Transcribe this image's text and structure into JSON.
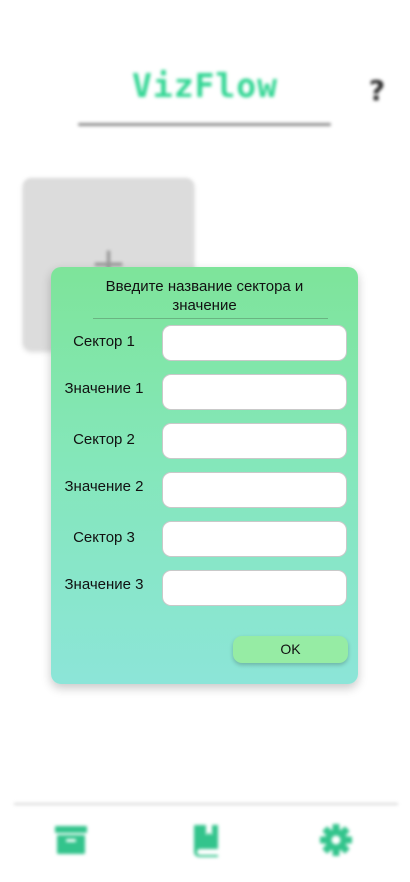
{
  "app": {
    "logo": "VizFlow",
    "help_label": "?",
    "add_card_plus": "+"
  },
  "dialog": {
    "title": "Введите название сектора и значение",
    "fields": [
      {
        "label": "Сектор 1",
        "value": ""
      },
      {
        "label": "Значение 1",
        "value": ""
      },
      {
        "label": "Сектор 2",
        "value": ""
      },
      {
        "label": "Значение 2",
        "value": ""
      },
      {
        "label": "Сектор 3",
        "value": ""
      },
      {
        "label": "Значение 3",
        "value": ""
      }
    ],
    "ok_label": "OK"
  },
  "bottom_nav": {
    "items": [
      {
        "icon": "archive-icon"
      },
      {
        "icon": "book-icon"
      },
      {
        "icon": "gear-icon"
      }
    ]
  },
  "colors": {
    "accent": "#33d694",
    "dialog_top": "#7ee49a",
    "dialog_bottom": "#8ce5d8",
    "ok_button": "#96eca4"
  }
}
